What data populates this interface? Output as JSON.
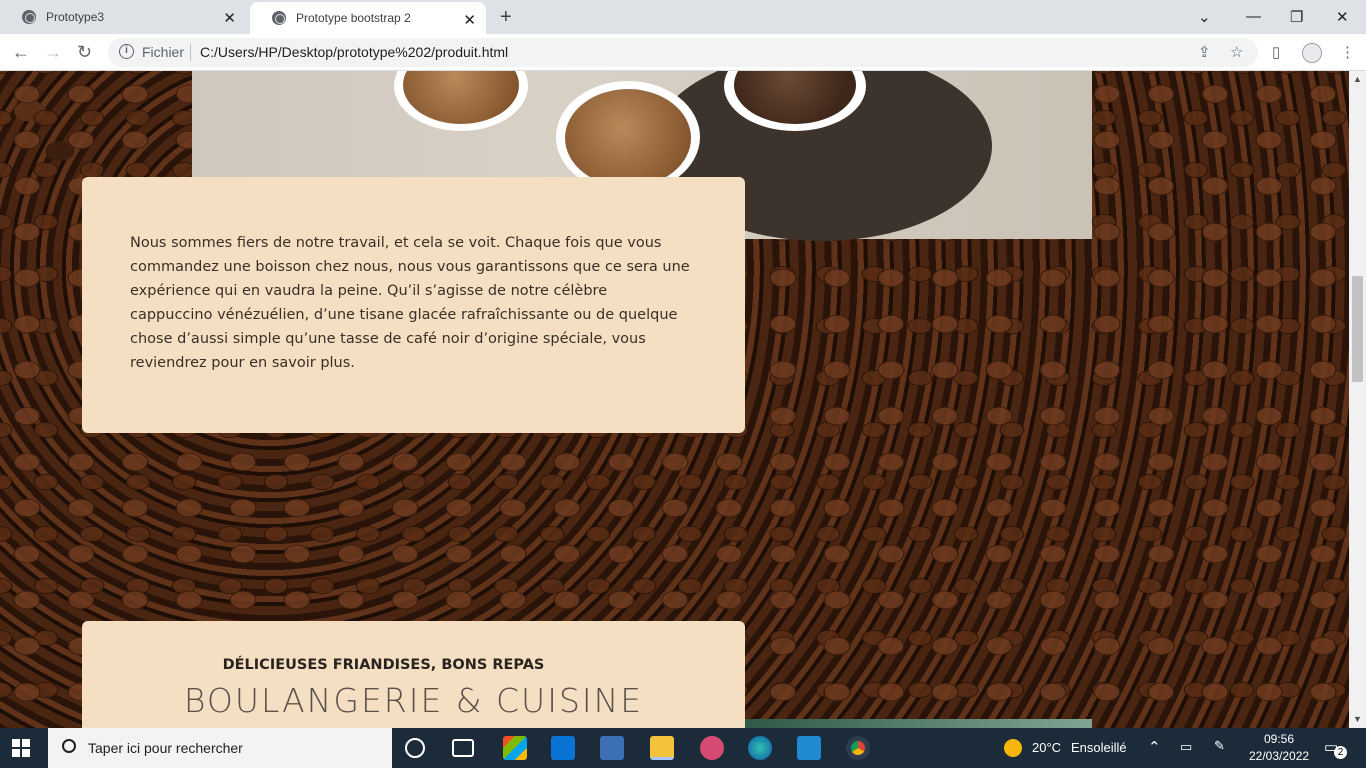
{
  "browser": {
    "tabs": [
      {
        "title": "Prototype3",
        "active": false
      },
      {
        "title": "Prototype bootstrap 2",
        "active": true
      }
    ],
    "new_tab_symbol": "+",
    "address": {
      "scheme_label": "Fichier",
      "url": "C:/Users/HP/Desktop/prototype%202/produit.html"
    }
  },
  "page": {
    "intro_text": "Nous sommes fiers de notre travail, et cela se voit. Chaque fois que vous commandez une boisson chez nous, nous vous garantissons que ce sera une expérience qui en vaudra la peine. Qu’il s’agisse de notre célèbre cappuccino vénézuélien, d’une tisane glacée rafraîchissante ou de quelque chose d’aussi simple qu’une tasse de café noir d’origine spéciale, vous reviendrez pour en savoir plus.",
    "section_subtitle": "DÉLICIEUSES FRIANDISES, BONS REPAS",
    "section_title": "BOULANGERIE & CUISINE"
  },
  "taskbar": {
    "search_placeholder": "Taper ici pour rechercher",
    "weather_temp": "20°C",
    "weather_desc": "Ensoleillé",
    "time": "09:56",
    "date": "22/03/2022",
    "notification_count": "2"
  }
}
